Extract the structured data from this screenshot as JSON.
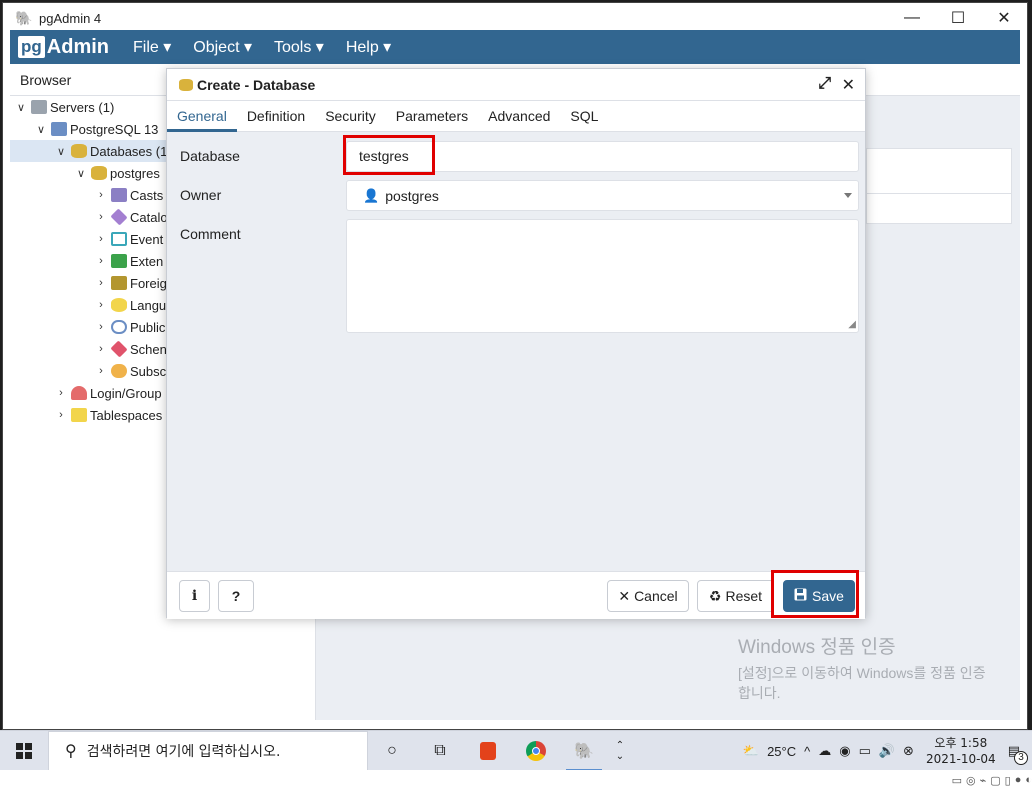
{
  "window": {
    "title": "pgAdmin 4",
    "min": "—",
    "max": "☐",
    "close": "✕"
  },
  "menubar": {
    "logo_pg": "pg",
    "logo_text": "Admin",
    "items": [
      "File ▾",
      "Object ▾",
      "Tools ▾",
      "Help ▾"
    ]
  },
  "browser": {
    "title": "Browser",
    "tree": [
      {
        "label": "Servers (1)",
        "chevron": "∨"
      },
      {
        "label": "PostgreSQL 13",
        "chevron": "∨"
      },
      {
        "label": "Databases (1",
        "chevron": "∨"
      },
      {
        "label": "postgres",
        "chevron": "∨"
      },
      {
        "label": "Casts",
        "chevron": "›"
      },
      {
        "label": "Catalo",
        "chevron": "›"
      },
      {
        "label": "Event",
        "chevron": "›"
      },
      {
        "label": "Exten",
        "chevron": "›"
      },
      {
        "label": "Foreig",
        "chevron": "›"
      },
      {
        "label": "Langu",
        "chevron": "›"
      },
      {
        "label": "Public",
        "chevron": "›"
      },
      {
        "label": "Schen",
        "chevron": "›"
      },
      {
        "label": "Subsc",
        "chevron": "›"
      },
      {
        "label": "Login/Group",
        "chevron": "›"
      },
      {
        "label": "Tablespaces",
        "chevron": "›"
      }
    ]
  },
  "dialog": {
    "title": "Create - Database",
    "expand": "⤢",
    "close": "✕",
    "tabs": [
      "General",
      "Definition",
      "Security",
      "Parameters",
      "Advanced",
      "SQL"
    ],
    "labels": {
      "database": "Database",
      "owner": "Owner",
      "comment": "Comment"
    },
    "values": {
      "database": "testgres",
      "owner": "postgres",
      "comment": ""
    },
    "buttons": {
      "info": "i",
      "help": "?",
      "cancel": "Cancel",
      "reset": "Reset",
      "save": "Save"
    }
  },
  "watermark": {
    "line1": "Windows 정품 인증",
    "line2": "[설정]으로 이동하여 Windows를 정품 인증합니다."
  },
  "taskbar": {
    "search_placeholder": "검색하려면 여기에 입력하십시오.",
    "weather": "25°C",
    "time": "오후 1:58",
    "date": "2021-10-04",
    "notifications": "3"
  },
  "colors": {
    "brand": "#326690",
    "highlight": "#e00000",
    "dialog_bg": "#ebeef3"
  }
}
